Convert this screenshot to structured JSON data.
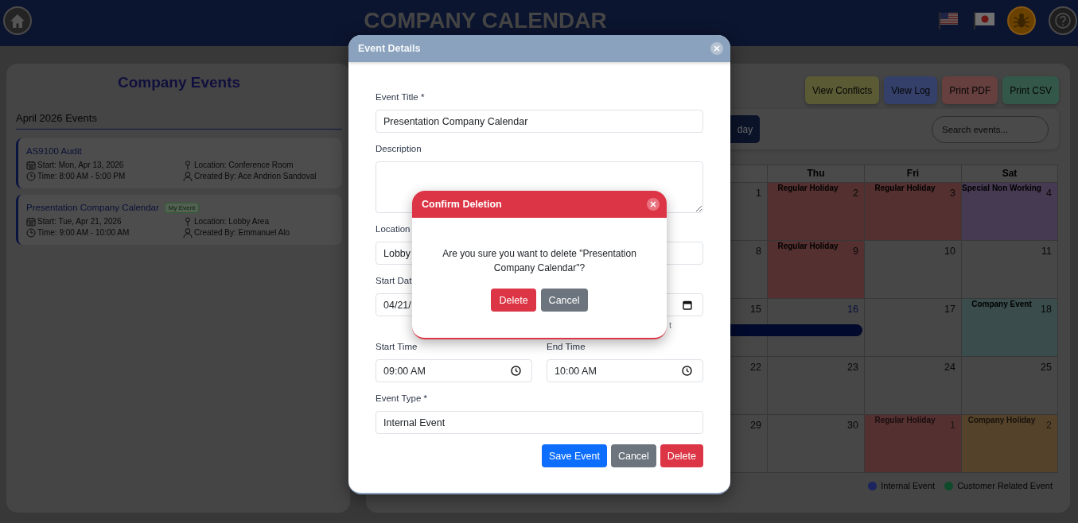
{
  "header": {
    "title": "COMPANY CALENDAR"
  },
  "sidebar": {
    "title": "Company Events",
    "section_title": "April 2026 Events",
    "events": [
      {
        "title": "AS9100 Audit",
        "details": [
          {
            "kind": "date",
            "text": "Start: Mon, Apr 13, 2026"
          },
          {
            "kind": "location",
            "text": "Location: Conference Room"
          },
          {
            "kind": "time",
            "text": "Time: 8:00 AM - 5:00 PM"
          },
          {
            "kind": "creator",
            "text": "Created By: Ace Andrion Sandoval"
          }
        ]
      },
      {
        "title": "Presentation Company Calendar",
        "badge": "My Event",
        "details": [
          {
            "kind": "date",
            "text": "Start: Tue, Apr 21, 2026"
          },
          {
            "kind": "location",
            "text": "Location: Lobby Area"
          },
          {
            "kind": "time",
            "text": "Time: 9:00 AM - 10:00 AM"
          },
          {
            "kind": "creator",
            "text": "Created By: Emmanuel Alo"
          }
        ]
      }
    ]
  },
  "calendar_panel": {
    "actions": [
      {
        "label": "View Conflicts",
        "color": "#5a5a34"
      },
      {
        "label": "View Log",
        "color": "#35406a"
      },
      {
        "label": "Print PDF",
        "color": "#663f3f"
      },
      {
        "label": "Print CSV",
        "color": "#33584a"
      }
    ],
    "view_button": {
      "label": "day"
    },
    "search": {
      "placeholder": "Search events..."
    },
    "calendar": {
      "weekdays": [
        "Thu",
        "Fri",
        "Sat"
      ],
      "weeks": [
        {
          "cells": [
            {
              "day": "1",
              "today": false,
              "other_month": false
            },
            {
              "day": "2",
              "label": "Regular Holiday",
              "color": "#553030",
              "today": false,
              "other_month": false
            },
            {
              "day": "3",
              "label": "Regular Holiday",
              "color": "#553030",
              "today": false,
              "other_month": false
            },
            {
              "day": "4",
              "label": "Special Non Working",
              "color": "#463a52",
              "today": false,
              "other_month": false
            }
          ]
        },
        {
          "cells": [
            {
              "day": "8",
              "today": false,
              "other_month": false
            },
            {
              "day": "9",
              "label": "Regular Holiday",
              "color": "#553030",
              "today": false,
              "other_month": false
            },
            {
              "day": "10",
              "today": false,
              "other_month": false
            },
            {
              "day": "11",
              "today": false,
              "other_month": false
            }
          ]
        },
        {
          "cells": [
            {
              "day": "15",
              "today": false,
              "other_month": false
            },
            {
              "day": "16",
              "today": true,
              "other_month": false
            },
            {
              "day": "17",
              "today": false,
              "other_month": false
            },
            {
              "day": "18",
              "label": "Company Event",
              "color": "#3a4c4c",
              "today": false,
              "other_month": false
            }
          ],
          "event_bar": {
            "color": "#010a2c"
          }
        },
        {
          "cells": [
            {
              "day": "22",
              "today": false,
              "other_month": false
            },
            {
              "day": "23",
              "today": false,
              "other_month": false
            },
            {
              "day": "24",
              "today": false,
              "other_month": false
            },
            {
              "day": "25",
              "today": false,
              "other_month": false
            }
          ]
        },
        {
          "cells": [
            {
              "day": "29",
              "today": false,
              "other_month": false
            },
            {
              "day": "30",
              "today": false,
              "other_month": false
            },
            {
              "day": "1",
              "label": "Regular Holiday",
              "color": "#553030",
              "today": false,
              "other_month": true
            },
            {
              "day": "2",
              "label": "Company Holiday",
              "color": "#54422a",
              "today": false,
              "other_month": true
            }
          ]
        }
      ]
    },
    "legend": [
      {
        "label": "Internal Event",
        "color": "#1c2560"
      },
      {
        "label": "Customer Related Event",
        "color": "#0f4a2a"
      }
    ]
  },
  "event_modal": {
    "title": "Event Details",
    "rows": [
      {
        "fields": [
          {
            "kind": "text",
            "label": "Event Title *",
            "value": "Presentation Company Calendar"
          }
        ]
      },
      {
        "fields": [
          {
            "kind": "textarea",
            "label": "Description"
          }
        ]
      },
      {
        "fields": [
          {
            "kind": "text",
            "label": "Location",
            "value": "Lobby"
          }
        ]
      },
      {
        "fields": [
          {
            "kind": "date",
            "label": "Start Dat",
            "value": "04/21/"
          },
          {
            "kind": "date",
            "picker_icon": true,
            "note": "t"
          }
        ]
      },
      {
        "fields": [
          {
            "kind": "time",
            "label": "Start Time",
            "value": "09:00 AM",
            "picker_icon": true
          },
          {
            "kind": "time",
            "label": "End Time",
            "value": "10:00 AM",
            "picker_icon": true
          }
        ]
      },
      {
        "fields": [
          {
            "kind": "text",
            "label": "Event Type *",
            "value": "Internal Event"
          }
        ]
      }
    ],
    "buttons": [
      {
        "label": "Save Event",
        "kind": "primary"
      },
      {
        "label": "Cancel",
        "kind": "secondary"
      },
      {
        "label": "Delete",
        "kind": "danger"
      }
    ]
  },
  "confirm_dialog": {
    "title": "Confirm Deletion",
    "message": "Are you sure you want to delete \"Presentation Company Calendar\"?",
    "buttons": [
      {
        "label": "Delete",
        "kind": "danger"
      },
      {
        "label": "Cancel",
        "kind": "secondary"
      }
    ]
  }
}
